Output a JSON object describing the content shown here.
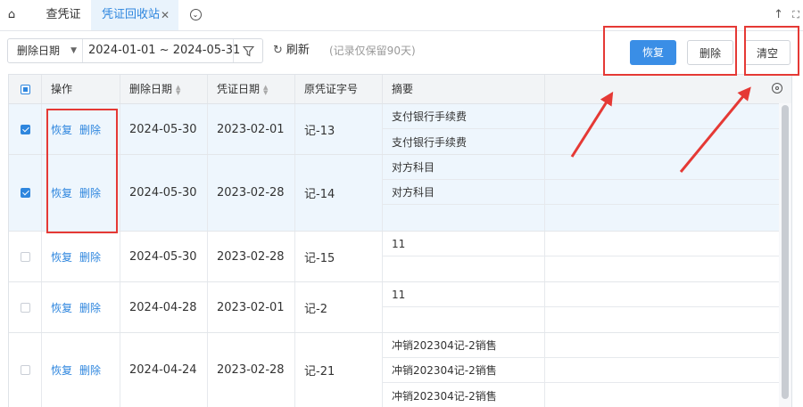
{
  "tabs": {
    "home_icon": "⌂",
    "voucher": "查凭证",
    "recycle": "凭证回收站",
    "close": "✕",
    "more": "⌄",
    "scroll_top_icon": "↑",
    "expand_icon": "⛶"
  },
  "toolbar": {
    "date_type": "删除日期",
    "date_range": "2024-01-01 ~ 2024-05-31",
    "refresh_label": "刷新",
    "hint": "(记录仅保留90天)",
    "restore_label": "恢复",
    "delete_label": "删除",
    "clear_label": "清空"
  },
  "table": {
    "headers": {
      "op": "操作",
      "delete_date": "删除日期",
      "voucher_date": "凭证日期",
      "voucher_no": "原凭证字号",
      "summary": "摘要"
    },
    "rows": [
      {
        "checked": true,
        "restore": "恢复",
        "delete": "删除",
        "delete_date": "2024-05-30",
        "voucher_date": "2023-02-01",
        "voucher_no": "记-13",
        "summaries": [
          "支付银行手续费",
          "支付银行手续费"
        ]
      },
      {
        "checked": true,
        "restore": "恢复",
        "delete": "删除",
        "delete_date": "2024-05-30",
        "voucher_date": "2023-02-28",
        "voucher_no": "记-14",
        "summaries": [
          "对方科目",
          "对方科目",
          ""
        ]
      },
      {
        "checked": false,
        "restore": "恢复",
        "delete": "删除",
        "delete_date": "2024-05-30",
        "voucher_date": "2023-02-28",
        "voucher_no": "记-15",
        "summaries": [
          "11",
          ""
        ]
      },
      {
        "checked": false,
        "restore": "恢复",
        "delete": "删除",
        "delete_date": "2024-04-28",
        "voucher_date": "2023-02-01",
        "voucher_no": "记-2",
        "summaries": [
          "11",
          ""
        ]
      },
      {
        "checked": false,
        "restore": "恢复",
        "delete": "删除",
        "delete_date": "2024-04-24",
        "voucher_date": "2023-02-28",
        "voucher_no": "记-21",
        "summaries": [
          "冲销202304记-2销售",
          "冲销202304记-2销售",
          "冲销202304记-2销售"
        ]
      }
    ]
  },
  "colors": {
    "accent": "#2e86de",
    "primary_button": "#3a8ee6",
    "selected_row": "#eef6fd",
    "annotation": "#e53935"
  }
}
